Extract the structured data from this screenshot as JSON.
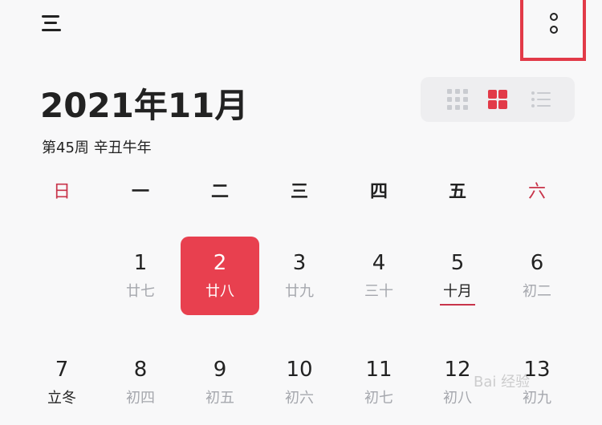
{
  "header": {
    "menu_icon": "menu-icon",
    "more_icon": "more-vertical-icon",
    "highlight_color": "#e23a48"
  },
  "title": {
    "month": "2021年11月",
    "week_info": "第45周 辛丑牛年"
  },
  "view_switcher": {
    "icons": [
      "grid-nine-icon",
      "grid-four-icon",
      "list-icon"
    ],
    "active": "grid-four-icon",
    "active_color": "#e23a48"
  },
  "weekdays": [
    "日",
    "一",
    "二",
    "三",
    "四",
    "五",
    "六"
  ],
  "weeks": [
    [
      null,
      {
        "day": "1",
        "lunar": "廿七"
      },
      {
        "day": "2",
        "lunar": "廿八"
      },
      {
        "day": "3",
        "lunar": "廿九"
      },
      {
        "day": "4",
        "lunar": "三十"
      },
      {
        "day": "5",
        "lunar": "十月"
      },
      {
        "day": "6",
        "lunar": "初二"
      }
    ],
    [
      {
        "day": "7",
        "lunar": "立冬"
      },
      {
        "day": "8",
        "lunar": "初四"
      },
      {
        "day": "9",
        "lunar": "初五"
      },
      {
        "day": "10",
        "lunar": "初六"
      },
      {
        "day": "11",
        "lunar": "初七"
      },
      {
        "day": "12",
        "lunar": "初八"
      },
      {
        "day": "13",
        "lunar": "初九"
      }
    ]
  ],
  "selected_day": "2",
  "selected_color": "#e8404f",
  "festival_day": "5",
  "watermark": "Bai 经验"
}
